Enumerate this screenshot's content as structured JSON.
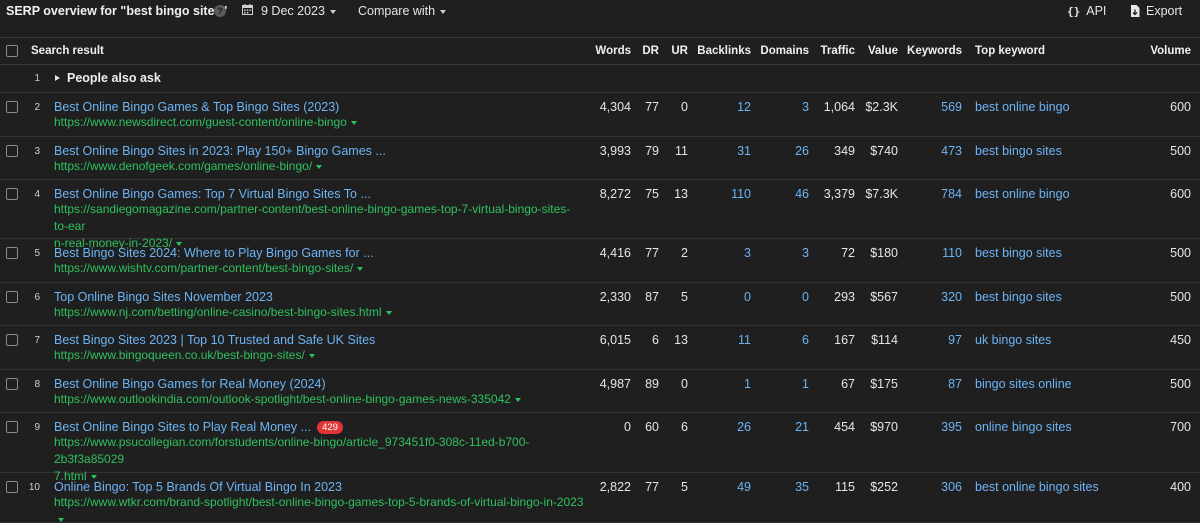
{
  "header": {
    "title": "SERP overview for \"best bingo sites\"",
    "help_glyph": "?",
    "date": "9 Dec 2023",
    "compare_label": "Compare with",
    "api_label": "API",
    "export_label": "Export"
  },
  "columns": {
    "search_result": "Search result",
    "words": "Words",
    "dr": "DR",
    "ur": "UR",
    "backlinks": "Backlinks",
    "domains": "Domains",
    "traffic": "Traffic",
    "value": "Value",
    "keywords": "Keywords",
    "top_keyword": "Top keyword",
    "volume": "Volume"
  },
  "paa": {
    "num": "1",
    "label": "People also ask"
  },
  "rows": [
    {
      "num": "2",
      "title": "Best Online Bingo Games & Top Bingo Sites (2023)",
      "url": "https://www.newsdirect.com/guest-content/online-bingo",
      "url2": "",
      "badge": "",
      "words": "4,304",
      "dr": "77",
      "ur": "0",
      "backlinks": "12",
      "domains": "3",
      "traffic": "1,064",
      "value": "$2.3K",
      "keywords": "569",
      "top_keyword": "best online bingo",
      "volume": "600"
    },
    {
      "num": "3",
      "title": "Best Online Bingo Sites in 2023: Play 150+ Bingo Games ...",
      "url": "https://www.denofgeek.com/games/online-bingo/",
      "url2": "",
      "badge": "",
      "words": "3,993",
      "dr": "79",
      "ur": "11",
      "backlinks": "31",
      "domains": "26",
      "traffic": "349",
      "value": "$740",
      "keywords": "473",
      "top_keyword": "best bingo sites",
      "volume": "500"
    },
    {
      "num": "4",
      "title": "Best Online Bingo Games: Top 7 Virtual Bingo Sites To ...",
      "url": "https://sandiegomagazine.com/partner-content/best-online-bingo-games-top-7-virtual-bingo-sites-to-ear",
      "url2": "n-real-money-in-2023/",
      "badge": "",
      "words": "8,272",
      "dr": "75",
      "ur": "13",
      "backlinks": "110",
      "domains": "46",
      "traffic": "3,379",
      "value": "$7.3K",
      "keywords": "784",
      "top_keyword": "best online bingo",
      "volume": "600"
    },
    {
      "num": "5",
      "title": "Best Bingo Sites 2024: Where to Play Bingo Games for ...",
      "url": "https://www.wishtv.com/partner-content/best-bingo-sites/",
      "url2": "",
      "badge": "",
      "words": "4,416",
      "dr": "77",
      "ur": "2",
      "backlinks": "3",
      "domains": "3",
      "traffic": "72",
      "value": "$180",
      "keywords": "110",
      "top_keyword": "best bingo sites",
      "volume": "500"
    },
    {
      "num": "6",
      "title": "Top Online Bingo Sites November 2023",
      "url": "https://www.nj.com/betting/online-casino/best-bingo-sites.html",
      "url2": "",
      "badge": "",
      "words": "2,330",
      "dr": "87",
      "ur": "5",
      "backlinks": "0",
      "domains": "0",
      "traffic": "293",
      "value": "$567",
      "keywords": "320",
      "top_keyword": "best bingo sites",
      "volume": "500"
    },
    {
      "num": "7",
      "title": "Best Bingo Sites 2023 | Top 10 Trusted and Safe UK Sites",
      "url": "https://www.bingoqueen.co.uk/best-bingo-sites/",
      "url2": "",
      "badge": "",
      "words": "6,015",
      "dr": "6",
      "ur": "13",
      "backlinks": "11",
      "domains": "6",
      "traffic": "167",
      "value": "$114",
      "keywords": "97",
      "top_keyword": "uk bingo sites",
      "volume": "450"
    },
    {
      "num": "8",
      "title": "Best Online Bingo Games for Real Money (2024)",
      "url": "https://www.outlookindia.com/outlook-spotlight/best-online-bingo-games-news-335042",
      "url2": "",
      "badge": "",
      "words": "4,987",
      "dr": "89",
      "ur": "0",
      "backlinks": "1",
      "domains": "1",
      "traffic": "67",
      "value": "$175",
      "keywords": "87",
      "top_keyword": "bingo sites online",
      "volume": "500"
    },
    {
      "num": "9",
      "title": "Best Online Bingo Sites to Play Real Money ...",
      "url": "https://www.psucollegian.com/forstudents/online-bingo/article_973451f0-308c-11ed-b700-2b3f3a85029",
      "url2": "7.html",
      "badge": "429",
      "words": "0",
      "dr": "60",
      "ur": "6",
      "backlinks": "26",
      "domains": "21",
      "traffic": "454",
      "value": "$970",
      "keywords": "395",
      "top_keyword": "online bingo sites",
      "volume": "700"
    },
    {
      "num": "10",
      "title": "Online Bingo: Top 5 Brands Of Virtual Bingo In 2023",
      "url": "https://www.wtkr.com/brand-spotlight/best-online-bingo-games-top-5-brands-of-virtual-bingo-in-2023",
      "url2": "",
      "badge": "",
      "words": "2,822",
      "dr": "77",
      "ur": "5",
      "backlinks": "49",
      "domains": "35",
      "traffic": "115",
      "value": "$252",
      "keywords": "306",
      "top_keyword": "best online bingo sites",
      "volume": "400"
    }
  ]
}
